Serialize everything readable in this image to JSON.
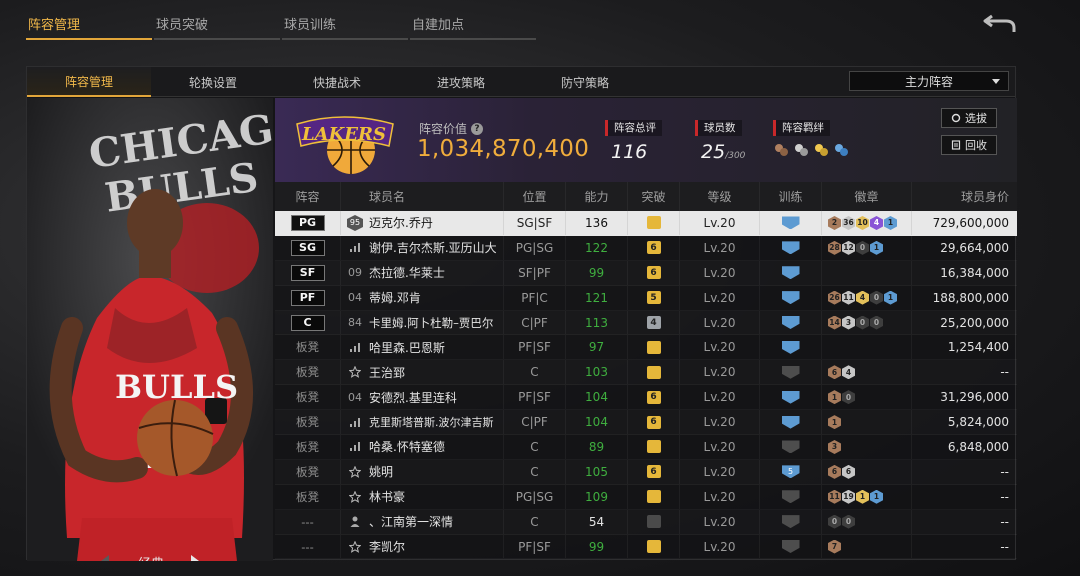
{
  "top_tabs": [
    {
      "label": "阵容管理",
      "active": true
    },
    {
      "label": "球员突破",
      "active": false
    },
    {
      "label": "球员训练",
      "active": false
    },
    {
      "label": "自建加点",
      "active": false
    }
  ],
  "sub_tabs": [
    {
      "label": "阵容管理",
      "active": true
    },
    {
      "label": "轮换设置",
      "active": false
    },
    {
      "label": "快捷战术",
      "active": false
    },
    {
      "label": "进攻策略",
      "active": false
    },
    {
      "label": "防守策略",
      "active": false
    }
  ],
  "lineup_select": {
    "value": "主力阵容"
  },
  "portrait": {
    "edition_label": "经典"
  },
  "team_header": {
    "value_label": "阵容价值",
    "value": "1,034,870,400",
    "rating_label": "阵容总评",
    "rating": "116",
    "count_label": "球员数",
    "count": "25",
    "count_max": "/300",
    "bond_label": "阵容羁绊",
    "select_button": "选拔",
    "recycle_button": "回收"
  },
  "table": {
    "headers": [
      "阵容",
      "球员名",
      "位置",
      "能力",
      "突破",
      "等级",
      "训练",
      "徽章",
      "球员身价"
    ],
    "rows": [
      {
        "slot": "PG",
        "starter": true,
        "jersey": "95",
        "jersey_style": "hex",
        "name": "迈克尔.乔丹",
        "role": "SG|SF",
        "ovr": "136",
        "ovr_green": false,
        "breakthrough": "",
        "brk_style": "gold",
        "level": "Lv.20",
        "training": "",
        "trn_style": "blue",
        "badges": [
          {
            "v": "2",
            "t": "bronze"
          },
          {
            "v": "36",
            "t": "silver"
          },
          {
            "v": "10",
            "t": "gold"
          },
          {
            "v": "4",
            "t": "purple"
          },
          {
            "v": "1",
            "t": "blue"
          }
        ],
        "salary": "729,600,000",
        "selected": true
      },
      {
        "slot": "SG",
        "starter": true,
        "jersey": "",
        "jersey_style": "bars",
        "name": "谢伊.吉尔杰斯.亚历山大",
        "role": "PG|SG",
        "ovr": "122",
        "ovr_green": true,
        "breakthrough": "6",
        "brk_style": "gold",
        "level": "Lv.20",
        "training": "",
        "trn_style": "blue",
        "badges": [
          {
            "v": "28",
            "t": "bronze"
          },
          {
            "v": "12",
            "t": "silver"
          },
          {
            "v": "0",
            "t": "dark"
          },
          {
            "v": "1",
            "t": "blue"
          }
        ],
        "salary": "29,664,000",
        "selected": false
      },
      {
        "slot": "SF",
        "starter": true,
        "jersey": "09",
        "jersey_style": "num",
        "name": "杰拉德.华莱士",
        "role": "SF|PF",
        "ovr": "99",
        "ovr_green": true,
        "breakthrough": "6",
        "brk_style": "gold",
        "level": "Lv.20",
        "training": "",
        "trn_style": "blue",
        "badges": [],
        "salary": "16,384,000",
        "selected": false
      },
      {
        "slot": "PF",
        "starter": true,
        "jersey": "04",
        "jersey_style": "num",
        "name": "蒂姆.邓肯",
        "role": "PF|C",
        "ovr": "121",
        "ovr_green": true,
        "breakthrough": "5",
        "brk_style": "gold",
        "level": "Lv.20",
        "training": "",
        "trn_style": "blue",
        "badges": [
          {
            "v": "26",
            "t": "bronze"
          },
          {
            "v": "11",
            "t": "silver"
          },
          {
            "v": "4",
            "t": "gold"
          },
          {
            "v": "0",
            "t": "dark"
          },
          {
            "v": "1",
            "t": "blue"
          }
        ],
        "salary": "188,800,000",
        "selected": false
      },
      {
        "slot": "C",
        "starter": true,
        "jersey": "84",
        "jersey_style": "num",
        "name": "卡里姆.阿卜杜勒–贾巴尔",
        "role": "C|PF",
        "ovr": "113",
        "ovr_green": true,
        "breakthrough": "4",
        "brk_style": "silver",
        "level": "Lv.20",
        "training": "",
        "trn_style": "blue",
        "badges": [
          {
            "v": "14",
            "t": "bronze"
          },
          {
            "v": "3",
            "t": "silver"
          },
          {
            "v": "0",
            "t": "dark"
          },
          {
            "v": "0",
            "t": "dark"
          }
        ],
        "salary": "25,200,000",
        "selected": false
      },
      {
        "slot": "板凳",
        "starter": false,
        "jersey": "",
        "jersey_style": "bars",
        "name": "哈里森.巴恩斯",
        "role": "PF|SF",
        "ovr": "97",
        "ovr_green": true,
        "breakthrough": "",
        "brk_style": "gold",
        "level": "Lv.20",
        "training": "",
        "trn_style": "blue",
        "badges": [],
        "salary": "1,254,400",
        "selected": false
      },
      {
        "slot": "板凳",
        "starter": false,
        "jersey": "",
        "jersey_style": "star",
        "name": "王治郅",
        "role": "C",
        "ovr": "103",
        "ovr_green": true,
        "breakthrough": "",
        "brk_style": "gold",
        "level": "Lv.20",
        "training": "",
        "trn_style": "gray",
        "badges": [
          {
            "v": "6",
            "t": "bronze"
          },
          {
            "v": "4",
            "t": "silver"
          }
        ],
        "salary": "--",
        "selected": false
      },
      {
        "slot": "板凳",
        "starter": false,
        "jersey": "04",
        "jersey_style": "num",
        "name": "安德烈.基里连科",
        "role": "PF|SF",
        "ovr": "104",
        "ovr_green": true,
        "breakthrough": "6",
        "brk_style": "gold",
        "level": "Lv.20",
        "training": "",
        "trn_style": "blue",
        "badges": [
          {
            "v": "1",
            "t": "bronze"
          },
          {
            "v": "0",
            "t": "dark"
          }
        ],
        "salary": "31,296,000",
        "selected": false
      },
      {
        "slot": "板凳",
        "starter": false,
        "jersey": "",
        "jersey_style": "bars",
        "name": "克里斯塔普斯.波尔津吉斯",
        "role": "C|PF",
        "ovr": "104",
        "ovr_green": true,
        "breakthrough": "6",
        "brk_style": "gold",
        "level": "Lv.20",
        "training": "",
        "trn_style": "blue",
        "badges": [
          {
            "v": "1",
            "t": "bronze"
          }
        ],
        "salary": "5,824,000",
        "selected": false
      },
      {
        "slot": "板凳",
        "starter": false,
        "jersey": "",
        "jersey_style": "bars",
        "name": "哈桑.怀特塞德",
        "role": "C",
        "ovr": "89",
        "ovr_green": true,
        "breakthrough": "",
        "brk_style": "gold",
        "level": "Lv.20",
        "training": "",
        "trn_style": "gray",
        "badges": [
          {
            "v": "3",
            "t": "bronze"
          }
        ],
        "salary": "6,848,000",
        "selected": false
      },
      {
        "slot": "板凳",
        "starter": false,
        "jersey": "",
        "jersey_style": "star",
        "name": "姚明",
        "role": "C",
        "ovr": "105",
        "ovr_green": true,
        "breakthrough": "6",
        "brk_style": "gold",
        "level": "Lv.20",
        "training": "5",
        "trn_style": "blue",
        "badges": [
          {
            "v": "6",
            "t": "bronze"
          },
          {
            "v": "6",
            "t": "silver"
          }
        ],
        "salary": "--",
        "selected": false
      },
      {
        "slot": "板凳",
        "starter": false,
        "jersey": "",
        "jersey_style": "star",
        "name": "林书豪",
        "role": "PG|SG",
        "ovr": "109",
        "ovr_green": true,
        "breakthrough": "",
        "brk_style": "gold",
        "level": "Lv.20",
        "training": "",
        "trn_style": "gray",
        "badges": [
          {
            "v": "11",
            "t": "bronze"
          },
          {
            "v": "19",
            "t": "silver"
          },
          {
            "v": "1",
            "t": "gold"
          },
          {
            "v": "1",
            "t": "blue"
          }
        ],
        "salary": "--",
        "selected": false
      },
      {
        "slot": "---",
        "starter": false,
        "jersey": "",
        "jersey_style": "person",
        "name": "、江南第一深情",
        "role": "C",
        "ovr": "54",
        "ovr_green": false,
        "breakthrough": "",
        "brk_style": "dim",
        "level": "Lv.20",
        "training": "",
        "trn_style": "gray",
        "badges": [
          {
            "v": "0",
            "t": "dark"
          },
          {
            "v": "0",
            "t": "dark"
          }
        ],
        "salary": "--",
        "selected": false
      },
      {
        "slot": "---",
        "starter": false,
        "jersey": "",
        "jersey_style": "star",
        "name": "李凯尔",
        "role": "PF|SF",
        "ovr": "99",
        "ovr_green": true,
        "breakthrough": "",
        "brk_style": "gold",
        "level": "Lv.20",
        "training": "",
        "trn_style": "gray",
        "badges": [
          {
            "v": "7",
            "t": "bronze"
          }
        ],
        "salary": "--",
        "selected": false
      }
    ]
  },
  "colors": {
    "accent": "#f1b84a",
    "value": "#f0ad3c",
    "green": "#3fae3f",
    "bulls_red": "#c8282a",
    "lakers_purple": "#552583"
  }
}
